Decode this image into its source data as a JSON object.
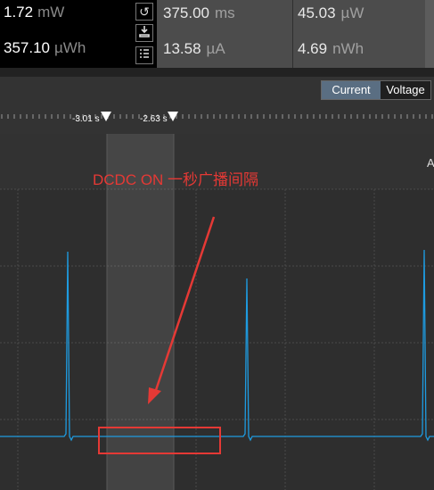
{
  "readouts": {
    "left": [
      {
        "value": "1.72",
        "unit": "mW"
      },
      {
        "value": "357.10",
        "unit": "µWh"
      }
    ],
    "middle": [
      {
        "value": "375.00",
        "unit": "ms"
      },
      {
        "value": "13.58",
        "unit": "µA"
      }
    ],
    "right": [
      {
        "value": "45.03",
        "unit": "µW"
      },
      {
        "value": "4.69",
        "unit": "nWh"
      }
    ]
  },
  "icons": [
    "reset-icon",
    "download-icon",
    "list-icon"
  ],
  "toolbar": {
    "current_label": "Current",
    "voltage_label": "Voltage",
    "active": "Current"
  },
  "markers": {
    "start_label": "-3.01 s",
    "end_label": "-2.63 s"
  },
  "plot": {
    "edge_label": "A",
    "annotation": "DCDC ON 一秒广播间隔",
    "trace_color": "#1e9be0",
    "annotation_color": "#e53935",
    "spike_count": 4
  }
}
